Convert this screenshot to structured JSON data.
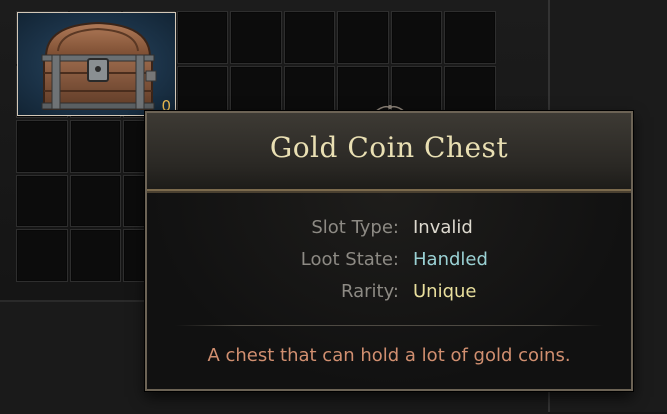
{
  "inventory": {
    "item_slot": {
      "name": "Gold Coin Chest",
      "count": "0",
      "icon": "treasure-chest-icon"
    }
  },
  "tooltip": {
    "title": "Gold Coin Chest",
    "properties": [
      {
        "label": "Slot Type",
        "value": "Invalid",
        "color": "#ddd9cf"
      },
      {
        "label": "Loot State",
        "value": "Handled",
        "color": "#9ad1d4"
      },
      {
        "label": "Rarity",
        "value": "Unique",
        "color": "#e9df9d"
      }
    ],
    "description": "A chest that can hold a lot of gold coins."
  },
  "colors": {
    "title": "#e9dfb3",
    "description": "#d18f70",
    "count": "#e8b84f"
  }
}
